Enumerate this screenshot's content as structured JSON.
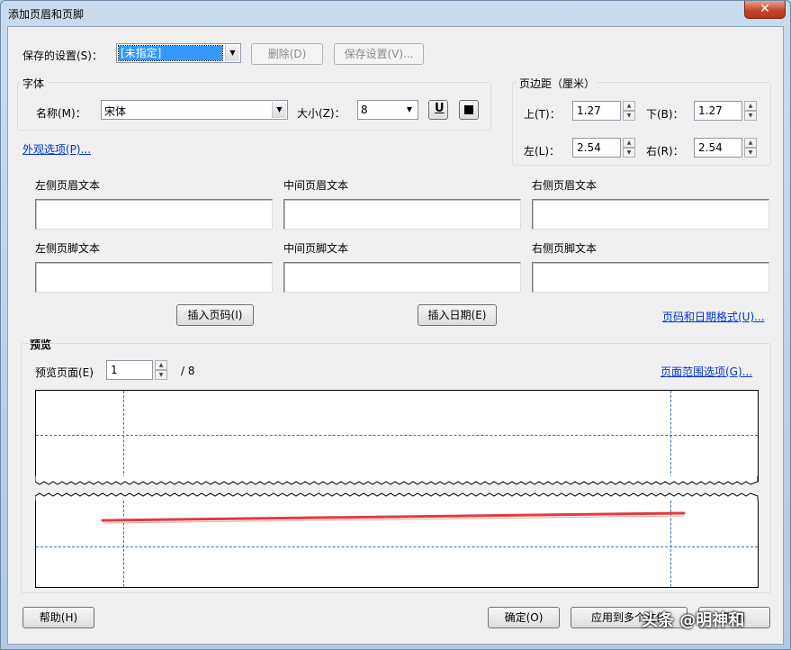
{
  "window": {
    "title": "添加页眉和页脚",
    "close_glyph": "✕"
  },
  "settings": {
    "label": "保存的设置(S)：",
    "value": "[未指定]",
    "delete_label": "删除(D)",
    "save_label": "保存设置(V)..."
  },
  "font": {
    "group_title": "字体",
    "name_label": "名称(M)：",
    "name_value": "宋体",
    "size_label": "大小(Z)：",
    "size_value": "8",
    "underline_glyph": "U"
  },
  "margins": {
    "group_title": "页边距（厘米）",
    "top_label": "上(T)：",
    "top_value": "1.27",
    "bottom_label": "下(B)：",
    "bottom_value": "1.27",
    "left_label": "左(L)：",
    "left_value": "2.54",
    "right_label": "右(R)：",
    "right_value": "2.54"
  },
  "appearance_link": "外观选项(P)...",
  "header_footer": {
    "left_header": "左侧页眉文本",
    "center_header": "中间页眉文本",
    "right_header": "右侧页眉文本",
    "left_footer": "左侧页脚文本",
    "center_footer": "中间页脚文本",
    "right_footer": "右侧页脚文本"
  },
  "insert": {
    "page_number_label": "插入页码(I)",
    "date_label": "插入日期(E)",
    "format_link": "页码和日期格式(U)..."
  },
  "preview": {
    "group_title": "预览",
    "page_label": "预览页面(E)",
    "page_value": "1",
    "page_total": "/ 8",
    "range_link": "页面范围选项(G)..."
  },
  "footer_buttons": {
    "help_label": "帮助(H)",
    "ok_label": "确定(O)",
    "apply_label": "应用到多个文件",
    "cancel_label": "取消"
  },
  "watermark": "头条 @明神和",
  "colors": {
    "link": "#0033cc",
    "selection": "#3399ff",
    "guide": "#3a6fb8",
    "stroke": "#e03c3c"
  }
}
